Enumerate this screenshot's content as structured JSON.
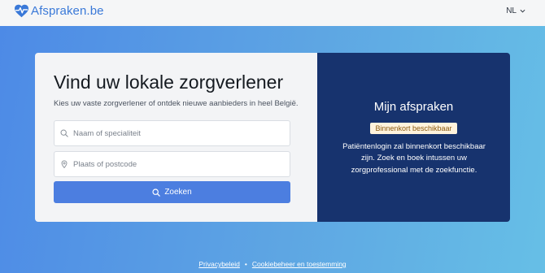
{
  "header": {
    "brand": "Afspraken.be",
    "language": "NL",
    "brand_color": "#3a79d8",
    "icons": {
      "logo": "heart-pulse-icon",
      "language": "chevron-down-icon"
    }
  },
  "search_panel": {
    "title": "Vind uw lokale zorgverlener",
    "subtitle": "Kies uw vaste zorgverlener of ontdek nieuwe aanbieders in heel België.",
    "name_field": {
      "placeholder": "Naam of specialiteit",
      "value": "",
      "icon": "search-icon"
    },
    "location_field": {
      "placeholder": "Plaats of postcode",
      "value": "",
      "icon": "map-pin-icon"
    },
    "search_button": {
      "label": "Zoeken",
      "icon": "search-icon",
      "color": "#4c7ee0"
    }
  },
  "appointments_panel": {
    "title": "Mijn afspraken",
    "badge": "Binnenkort beschikbaar",
    "text": "Patiëntenlogin zal binnenkort beschikbaar zijn. Zoek en boek intussen uw zorgprofessional met de zoekfunctie.",
    "background": "#17336e"
  },
  "footer": {
    "privacy": "Privacybeleid",
    "separator": "•",
    "cookies": "Cookiebeheer en toestemming"
  }
}
